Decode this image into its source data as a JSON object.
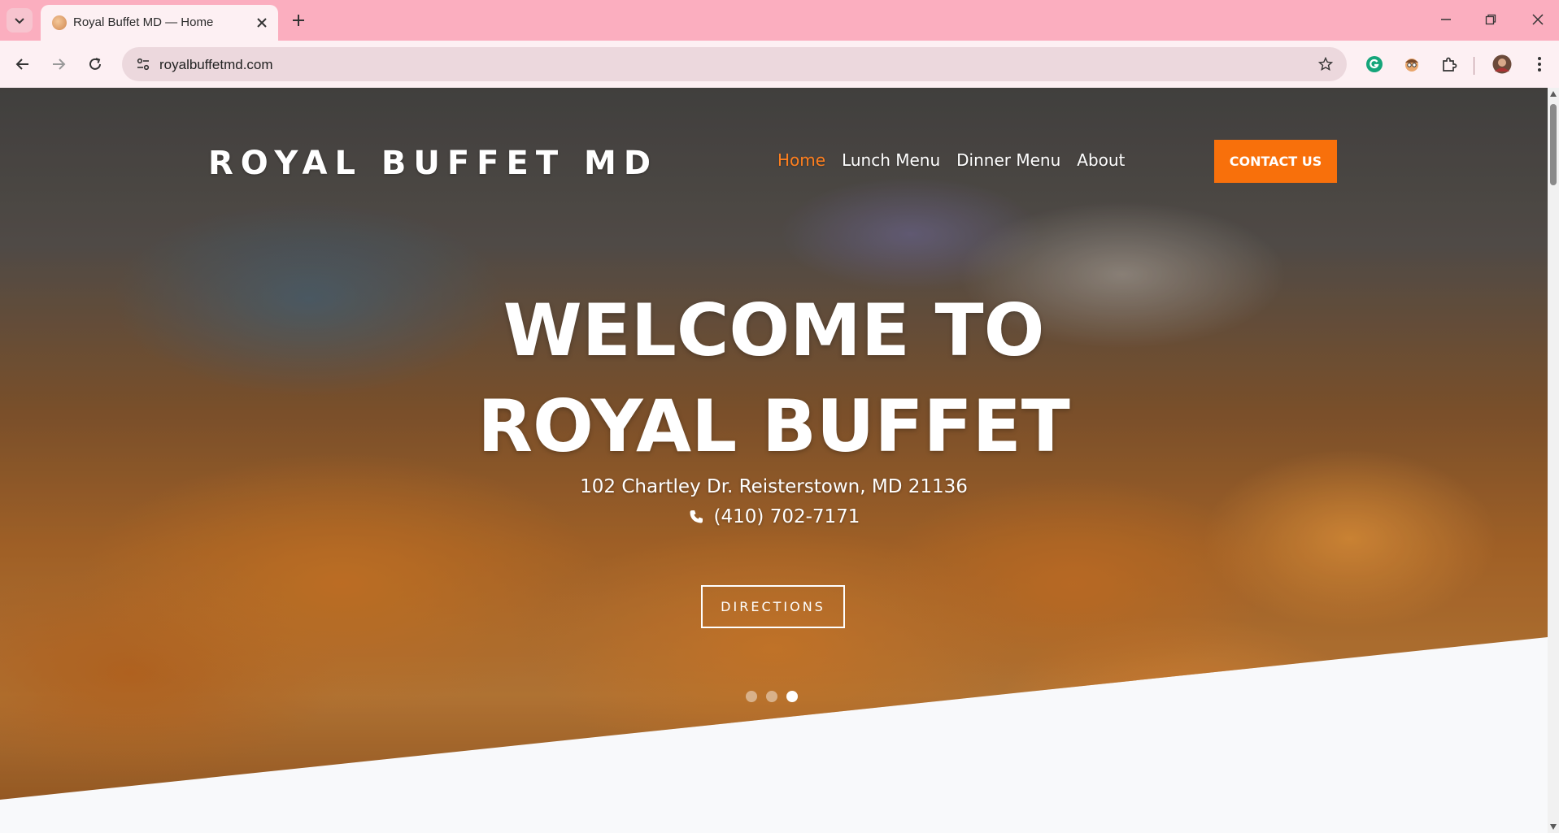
{
  "browser": {
    "tab_title": "Royal Buffet MD — Home",
    "url": "royalbuffetmd.com",
    "chrome_color": "#fbaebf"
  },
  "site": {
    "logo": "ROYAL BUFFET MD",
    "nav": [
      {
        "label": "Home",
        "active": true
      },
      {
        "label": "Lunch Menu",
        "active": false
      },
      {
        "label": "Dinner Menu",
        "active": false
      },
      {
        "label": "About",
        "active": false
      }
    ],
    "contact_button": "CONTACT US",
    "accent_color": "#f8700b"
  },
  "hero": {
    "headline_line1": "WELCOME TO",
    "headline_line2": "ROYAL BUFFET",
    "address": "102 Chartley Dr. Reisterstown, MD 21136",
    "phone": "(410) 702-7171",
    "directions_button": "DIRECTIONS",
    "slides": 3,
    "active_slide": 3
  }
}
